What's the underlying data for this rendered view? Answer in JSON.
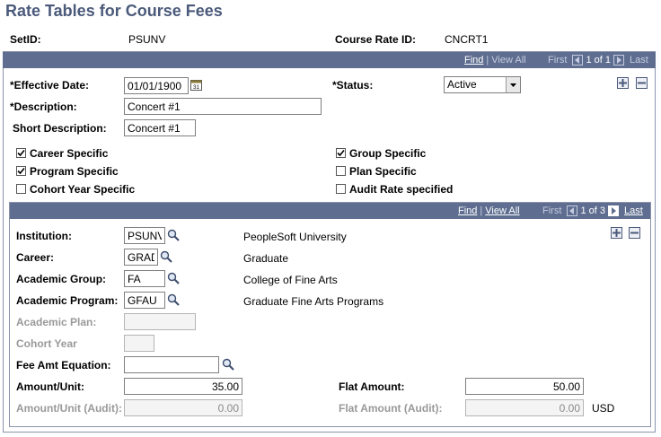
{
  "page": {
    "title": "Rate Tables for Course Fees"
  },
  "keys": {
    "setid_label": "SetID:",
    "setid_value": "PSUNV",
    "rate_id_label": "Course Rate ID:",
    "rate_id_value": "CNCRT1"
  },
  "outer_nav": {
    "find": "Find",
    "view_all": "View All",
    "first": "First",
    "count": "1 of 1",
    "last": "Last"
  },
  "effective": {
    "date_label": "*Effective Date:",
    "date_value": "01/01/1900",
    "status_label": "*Status:",
    "status_value": "Active",
    "desc_label": "*Description:",
    "desc_value": "Concert #1",
    "short_label": "Short Description:",
    "short_value": "Concert #1"
  },
  "checks": {
    "career": {
      "label": "Career Specific",
      "checked": true
    },
    "program": {
      "label": "Program Specific",
      "checked": true
    },
    "cohort": {
      "label": "Cohort Year Specific",
      "checked": false
    },
    "group": {
      "label": "Group Specific",
      "checked": true
    },
    "plan": {
      "label": "Plan Specific",
      "checked": false
    },
    "audit": {
      "label": "Audit Rate specified",
      "checked": false
    }
  },
  "inner_nav": {
    "find": "Find",
    "view_all": "View All",
    "first": "First",
    "count": "1 of 3",
    "last": "Last"
  },
  "detail": {
    "institution_label": "Institution:",
    "institution_value": "PSUNV",
    "institution_desc": "PeopleSoft University",
    "career_label": "Career:",
    "career_value": "GRAD",
    "career_desc": "Graduate",
    "group_label": "Academic Group:",
    "group_value": "FA",
    "group_desc": "College of Fine Arts",
    "program_label": "Academic Program:",
    "program_value": "GFAU",
    "program_desc": "Graduate Fine Arts Programs",
    "plan_label": "Academic Plan:",
    "cohort_label": "Cohort Year",
    "fee_eq_label": "Fee Amt Equation:",
    "amount_unit_label": "Amount/Unit:",
    "amount_unit_value": "35.00",
    "flat_label": "Flat Amount:",
    "flat_value": "50.00",
    "amount_audit_label": "Amount/Unit (Audit):",
    "amount_audit_value": "0.00",
    "flat_audit_label": "Flat Amount (Audit):",
    "flat_audit_value": "0.00",
    "currency": "USD"
  }
}
